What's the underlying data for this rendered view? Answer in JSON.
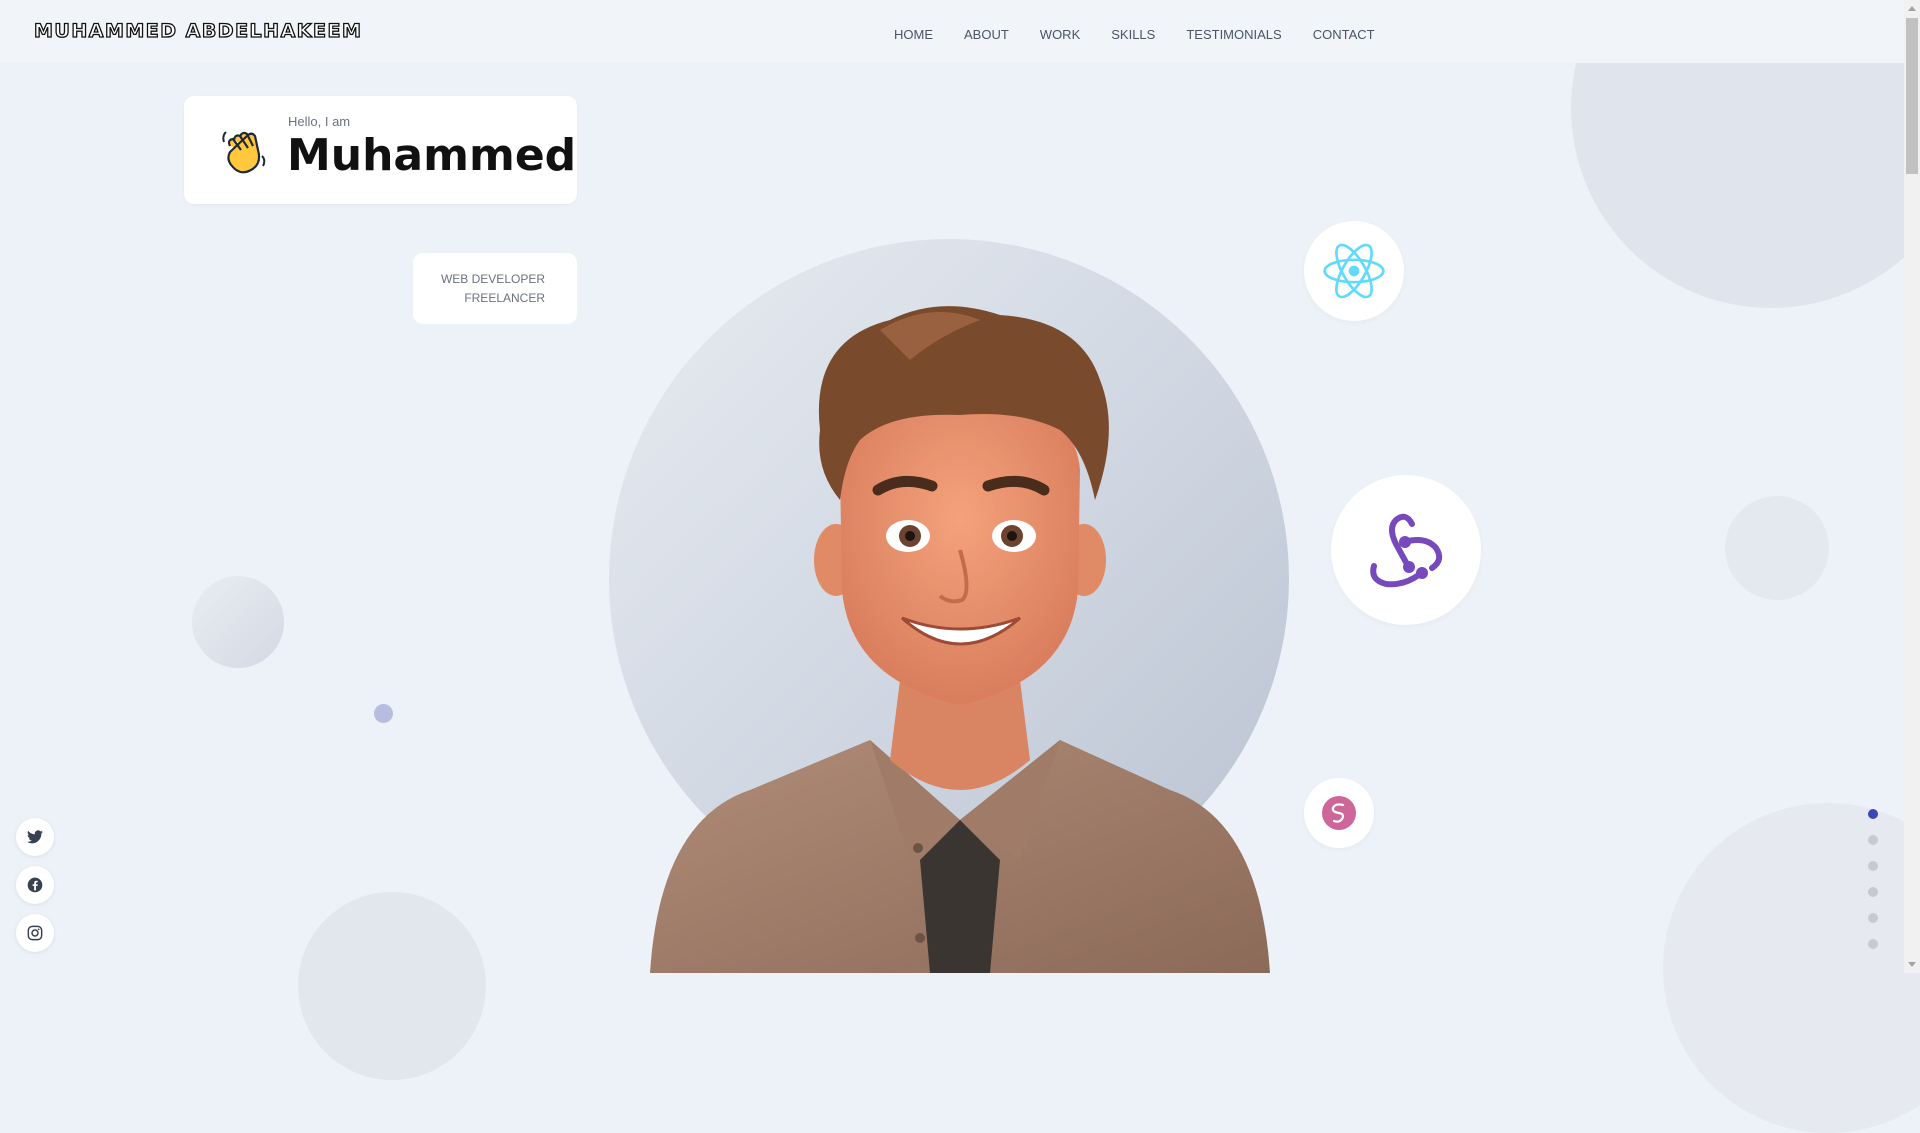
{
  "header": {
    "logo": "MUHAMMED ABDELHAKEEM",
    "nav": [
      "HOME",
      "ABOUT",
      "WORK",
      "SKILLS",
      "TESTIMONIALS",
      "CONTACT"
    ]
  },
  "hero": {
    "greeting": "Hello, I am",
    "name": "Muhammed",
    "roles": [
      "WEB DEVELOPER",
      "FREELANCER"
    ],
    "wave_icon": "waving-hand-icon",
    "avatar": "3d-cartoon-avatar"
  },
  "tech_icons": [
    "react-icon",
    "redux-icon",
    "sass-icon"
  ],
  "social_links": [
    "twitter-icon",
    "facebook-icon",
    "instagram-icon"
  ],
  "section_pager": {
    "count": 6,
    "active": 1
  },
  "colors": {
    "background": "#edf2f8",
    "react": "#61dafb",
    "redux": "#764abc",
    "sass": "#cd6799",
    "pager_active": "#3b46b5"
  }
}
